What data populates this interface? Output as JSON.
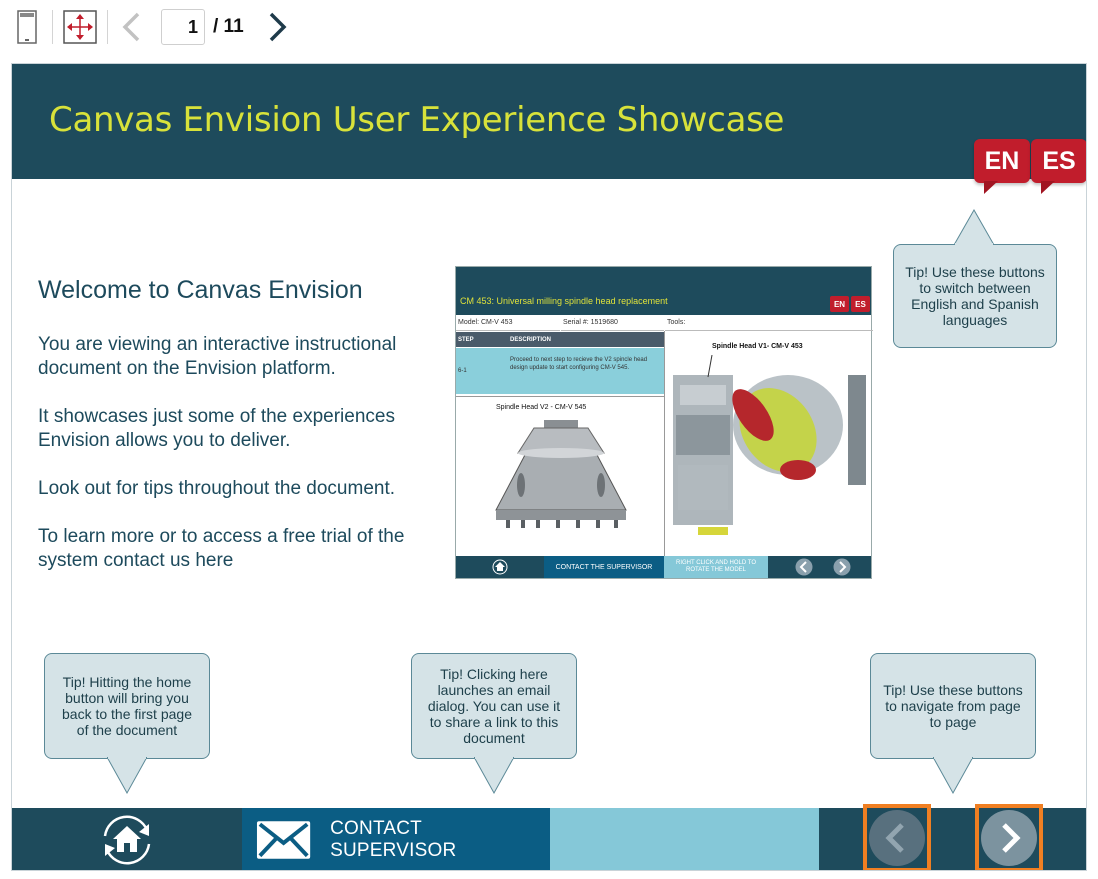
{
  "toolbar": {
    "page_current": "1",
    "page_total": "/ 11",
    "icons": [
      "single-page-icon",
      "fit-screen-icon",
      "prev-page-icon",
      "next-page-icon"
    ]
  },
  "slide": {
    "title": "Canvas Envision User Experience Showcase",
    "lang_en": "EN",
    "lang_es": "ES",
    "welcome_heading": "Welcome to Canvas Envision",
    "paragraphs": [
      "You are viewing an interactive instructional document on the Envision platform.",
      "It showcases just some of the experiences Envision allows you to deliver.",
      "Look out for tips throughout the document.",
      "To learn more or to access a free trial of the system contact us here"
    ]
  },
  "tips": {
    "language": "Tip! Use these buttons to switch between English and Spanish languages",
    "home": "Tip! Hitting the home button will bring you back to the first page of the document",
    "email": "Tip! Clicking here launches an email dialog. You can use it to share a link to this document",
    "navigate": "Tip! Use these buttons to navigate from page to page"
  },
  "screenshot": {
    "title": "CM 453: Universal milling spindle head replacement",
    "model": "Model: CM-V 453",
    "serial": "Serial #: 1519680",
    "tools": "Tools:",
    "col_step": "STEP",
    "col_desc": "DESCRIPTION",
    "step_no": "6-1",
    "step_desc": "Proceed to next step to recieve the V2 spincle head design update to start configuring CM-V 545.",
    "label_v2": "Spindle Head V2 - CM-V 545",
    "label_v1": "Spindle Head V1- CM-V 453",
    "contact": "CONTACT THE SUPERVISOR",
    "rotate": "RIGHT CLICK AND HOLD TO ROTATE THE MODEL",
    "lang_en": "EN",
    "lang_es": "ES"
  },
  "footer": {
    "contact_label": "CONTACT SUPERVISOR"
  },
  "colors": {
    "header_bg": "#1e4b5c",
    "title": "#d8e23a",
    "lang_red": "#c11d2c",
    "contact_bg": "#0b5d84",
    "light_bar": "#85c8d8",
    "highlight": "#f07f22"
  }
}
